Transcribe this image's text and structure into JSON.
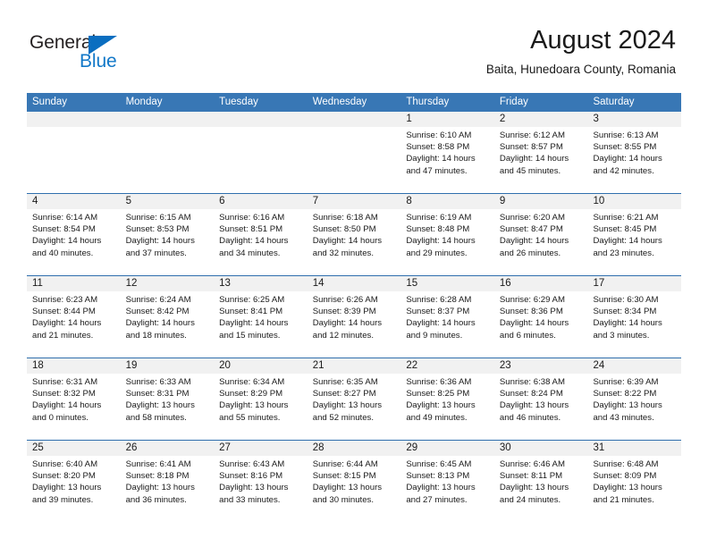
{
  "brand": {
    "name_part1": "General",
    "name_part2": "Blue",
    "color_primary": "#1278c8",
    "color_dark": "#231f20"
  },
  "header": {
    "title": "August 2024",
    "subtitle": "Baita, Hunedoara County, Romania"
  },
  "theme": {
    "header_blue": "#3877b5",
    "rule_blue": "#2f6fad",
    "numberband_gray": "#f1f1f1"
  },
  "calendar": {
    "weekday_headers": [
      "Sunday",
      "Monday",
      "Tuesday",
      "Wednesday",
      "Thursday",
      "Friday",
      "Saturday"
    ],
    "weeks": [
      [
        {
          "day": "",
          "sunrise": "",
          "sunset": "",
          "daylight_line1": "",
          "daylight_line2": ""
        },
        {
          "day": "",
          "sunrise": "",
          "sunset": "",
          "daylight_line1": "",
          "daylight_line2": ""
        },
        {
          "day": "",
          "sunrise": "",
          "sunset": "",
          "daylight_line1": "",
          "daylight_line2": ""
        },
        {
          "day": "",
          "sunrise": "",
          "sunset": "",
          "daylight_line1": "",
          "daylight_line2": ""
        },
        {
          "day": "1",
          "sunrise": "Sunrise: 6:10 AM",
          "sunset": "Sunset: 8:58 PM",
          "daylight_line1": "Daylight: 14 hours",
          "daylight_line2": "and 47 minutes."
        },
        {
          "day": "2",
          "sunrise": "Sunrise: 6:12 AM",
          "sunset": "Sunset: 8:57 PM",
          "daylight_line1": "Daylight: 14 hours",
          "daylight_line2": "and 45 minutes."
        },
        {
          "day": "3",
          "sunrise": "Sunrise: 6:13 AM",
          "sunset": "Sunset: 8:55 PM",
          "daylight_line1": "Daylight: 14 hours",
          "daylight_line2": "and 42 minutes."
        }
      ],
      [
        {
          "day": "4",
          "sunrise": "Sunrise: 6:14 AM",
          "sunset": "Sunset: 8:54 PM",
          "daylight_line1": "Daylight: 14 hours",
          "daylight_line2": "and 40 minutes."
        },
        {
          "day": "5",
          "sunrise": "Sunrise: 6:15 AM",
          "sunset": "Sunset: 8:53 PM",
          "daylight_line1": "Daylight: 14 hours",
          "daylight_line2": "and 37 minutes."
        },
        {
          "day": "6",
          "sunrise": "Sunrise: 6:16 AM",
          "sunset": "Sunset: 8:51 PM",
          "daylight_line1": "Daylight: 14 hours",
          "daylight_line2": "and 34 minutes."
        },
        {
          "day": "7",
          "sunrise": "Sunrise: 6:18 AM",
          "sunset": "Sunset: 8:50 PM",
          "daylight_line1": "Daylight: 14 hours",
          "daylight_line2": "and 32 minutes."
        },
        {
          "day": "8",
          "sunrise": "Sunrise: 6:19 AM",
          "sunset": "Sunset: 8:48 PM",
          "daylight_line1": "Daylight: 14 hours",
          "daylight_line2": "and 29 minutes."
        },
        {
          "day": "9",
          "sunrise": "Sunrise: 6:20 AM",
          "sunset": "Sunset: 8:47 PM",
          "daylight_line1": "Daylight: 14 hours",
          "daylight_line2": "and 26 minutes."
        },
        {
          "day": "10",
          "sunrise": "Sunrise: 6:21 AM",
          "sunset": "Sunset: 8:45 PM",
          "daylight_line1": "Daylight: 14 hours",
          "daylight_line2": "and 23 minutes."
        }
      ],
      [
        {
          "day": "11",
          "sunrise": "Sunrise: 6:23 AM",
          "sunset": "Sunset: 8:44 PM",
          "daylight_line1": "Daylight: 14 hours",
          "daylight_line2": "and 21 minutes."
        },
        {
          "day": "12",
          "sunrise": "Sunrise: 6:24 AM",
          "sunset": "Sunset: 8:42 PM",
          "daylight_line1": "Daylight: 14 hours",
          "daylight_line2": "and 18 minutes."
        },
        {
          "day": "13",
          "sunrise": "Sunrise: 6:25 AM",
          "sunset": "Sunset: 8:41 PM",
          "daylight_line1": "Daylight: 14 hours",
          "daylight_line2": "and 15 minutes."
        },
        {
          "day": "14",
          "sunrise": "Sunrise: 6:26 AM",
          "sunset": "Sunset: 8:39 PM",
          "daylight_line1": "Daylight: 14 hours",
          "daylight_line2": "and 12 minutes."
        },
        {
          "day": "15",
          "sunrise": "Sunrise: 6:28 AM",
          "sunset": "Sunset: 8:37 PM",
          "daylight_line1": "Daylight: 14 hours",
          "daylight_line2": "and 9 minutes."
        },
        {
          "day": "16",
          "sunrise": "Sunrise: 6:29 AM",
          "sunset": "Sunset: 8:36 PM",
          "daylight_line1": "Daylight: 14 hours",
          "daylight_line2": "and 6 minutes."
        },
        {
          "day": "17",
          "sunrise": "Sunrise: 6:30 AM",
          "sunset": "Sunset: 8:34 PM",
          "daylight_line1": "Daylight: 14 hours",
          "daylight_line2": "and 3 minutes."
        }
      ],
      [
        {
          "day": "18",
          "sunrise": "Sunrise: 6:31 AM",
          "sunset": "Sunset: 8:32 PM",
          "daylight_line1": "Daylight: 14 hours",
          "daylight_line2": "and 0 minutes."
        },
        {
          "day": "19",
          "sunrise": "Sunrise: 6:33 AM",
          "sunset": "Sunset: 8:31 PM",
          "daylight_line1": "Daylight: 13 hours",
          "daylight_line2": "and 58 minutes."
        },
        {
          "day": "20",
          "sunrise": "Sunrise: 6:34 AM",
          "sunset": "Sunset: 8:29 PM",
          "daylight_line1": "Daylight: 13 hours",
          "daylight_line2": "and 55 minutes."
        },
        {
          "day": "21",
          "sunrise": "Sunrise: 6:35 AM",
          "sunset": "Sunset: 8:27 PM",
          "daylight_line1": "Daylight: 13 hours",
          "daylight_line2": "and 52 minutes."
        },
        {
          "day": "22",
          "sunrise": "Sunrise: 6:36 AM",
          "sunset": "Sunset: 8:25 PM",
          "daylight_line1": "Daylight: 13 hours",
          "daylight_line2": "and 49 minutes."
        },
        {
          "day": "23",
          "sunrise": "Sunrise: 6:38 AM",
          "sunset": "Sunset: 8:24 PM",
          "daylight_line1": "Daylight: 13 hours",
          "daylight_line2": "and 46 minutes."
        },
        {
          "day": "24",
          "sunrise": "Sunrise: 6:39 AM",
          "sunset": "Sunset: 8:22 PM",
          "daylight_line1": "Daylight: 13 hours",
          "daylight_line2": "and 43 minutes."
        }
      ],
      [
        {
          "day": "25",
          "sunrise": "Sunrise: 6:40 AM",
          "sunset": "Sunset: 8:20 PM",
          "daylight_line1": "Daylight: 13 hours",
          "daylight_line2": "and 39 minutes."
        },
        {
          "day": "26",
          "sunrise": "Sunrise: 6:41 AM",
          "sunset": "Sunset: 8:18 PM",
          "daylight_line1": "Daylight: 13 hours",
          "daylight_line2": "and 36 minutes."
        },
        {
          "day": "27",
          "sunrise": "Sunrise: 6:43 AM",
          "sunset": "Sunset: 8:16 PM",
          "daylight_line1": "Daylight: 13 hours",
          "daylight_line2": "and 33 minutes."
        },
        {
          "day": "28",
          "sunrise": "Sunrise: 6:44 AM",
          "sunset": "Sunset: 8:15 PM",
          "daylight_line1": "Daylight: 13 hours",
          "daylight_line2": "and 30 minutes."
        },
        {
          "day": "29",
          "sunrise": "Sunrise: 6:45 AM",
          "sunset": "Sunset: 8:13 PM",
          "daylight_line1": "Daylight: 13 hours",
          "daylight_line2": "and 27 minutes."
        },
        {
          "day": "30",
          "sunrise": "Sunrise: 6:46 AM",
          "sunset": "Sunset: 8:11 PM",
          "daylight_line1": "Daylight: 13 hours",
          "daylight_line2": "and 24 minutes."
        },
        {
          "day": "31",
          "sunrise": "Sunrise: 6:48 AM",
          "sunset": "Sunset: 8:09 PM",
          "daylight_line1": "Daylight: 13 hours",
          "daylight_line2": "and 21 minutes."
        }
      ]
    ]
  }
}
